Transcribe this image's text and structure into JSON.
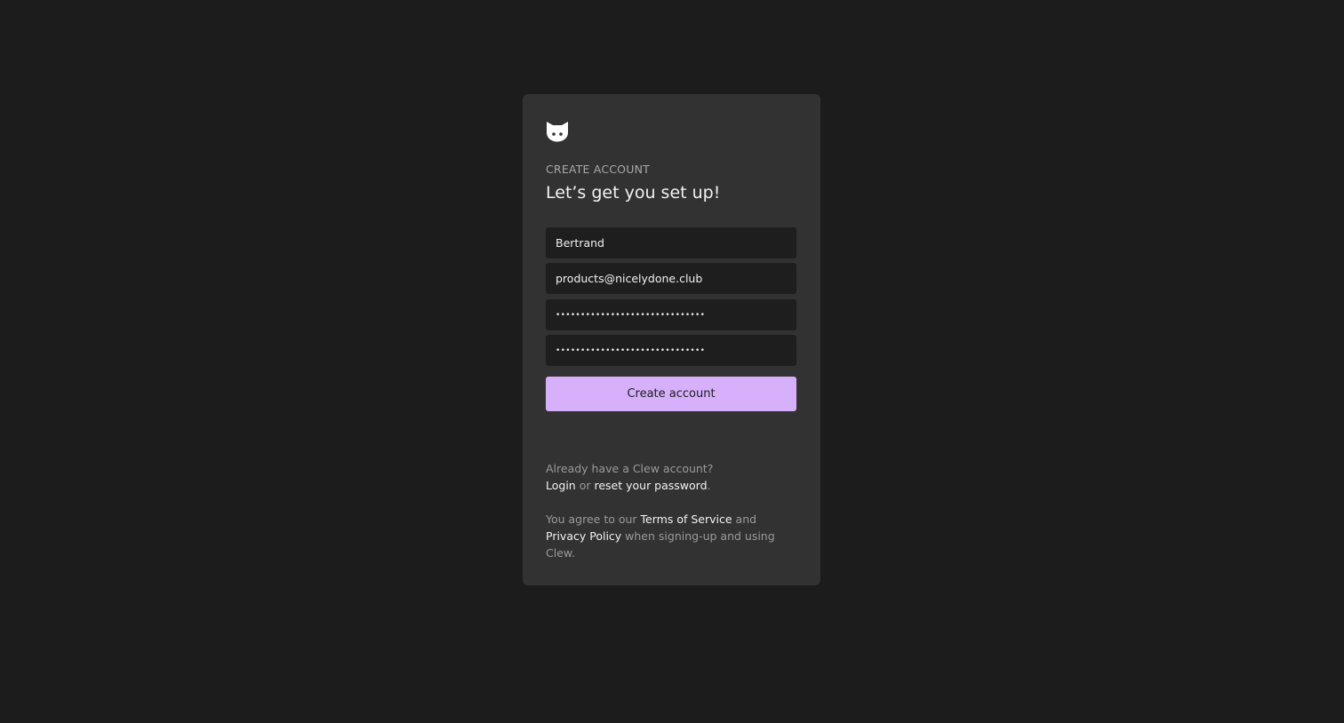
{
  "card": {
    "eyebrow": "CREATE ACCOUNT",
    "title": "Let’s get you set up!"
  },
  "form": {
    "name_value": "Bertrand",
    "email_value": "products@nicelydone.club",
    "password_value": "••••••••••••••••••••••••••••••",
    "confirm_password_value": "••••••••••••••••••••••••••••••",
    "submit_label": "Create account"
  },
  "footer": {
    "already_text": "Already have a Clew account?",
    "login_label": "Login",
    "or_text": " or ",
    "reset_label": "reset your password",
    "period": ".",
    "agree_prefix": "You agree to our ",
    "terms_label": "Terms of Service",
    "and_text": " and ",
    "privacy_label": "Privacy Policy",
    "agree_suffix": " when signing-up and using Clew."
  },
  "colors": {
    "background": "#1c1c1c",
    "card": "#323232",
    "field": "#1e1e1e",
    "accent": "#d6b0fa"
  },
  "icons": {
    "logo": "cat-logo-icon"
  }
}
